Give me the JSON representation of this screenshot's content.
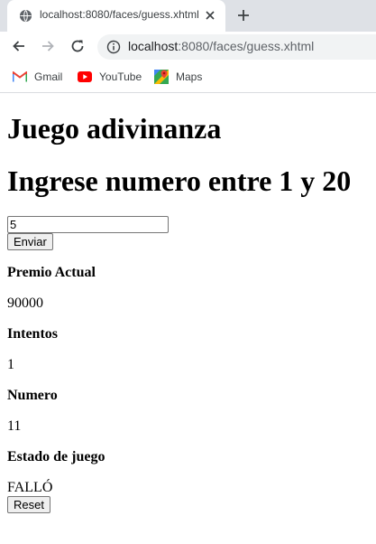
{
  "browser": {
    "tab_title": "localhost:8080/faces/guess.xhtml",
    "url_host": "localhost",
    "url_rest": ":8080/faces/guess.xhtml",
    "bookmarks": [
      {
        "label": "Gmail",
        "icon": "gmail-icon"
      },
      {
        "label": "YouTube",
        "icon": "youtube-icon"
      },
      {
        "label": "Maps",
        "icon": "maps-icon"
      }
    ]
  },
  "page": {
    "title": "Juego adivinanza",
    "subtitle": "Ingrese numero entre 1 y 20",
    "guess_value": "5",
    "submit_label": "Enviar",
    "prize_label": "Premio Actual",
    "prize_value": "90000",
    "attempts_label": "Intentos",
    "attempts_value": "1",
    "number_label": "Numero",
    "number_value": "11",
    "status_label": "Estado de juego",
    "status_value": "FALLÓ",
    "reset_label": "Reset"
  }
}
